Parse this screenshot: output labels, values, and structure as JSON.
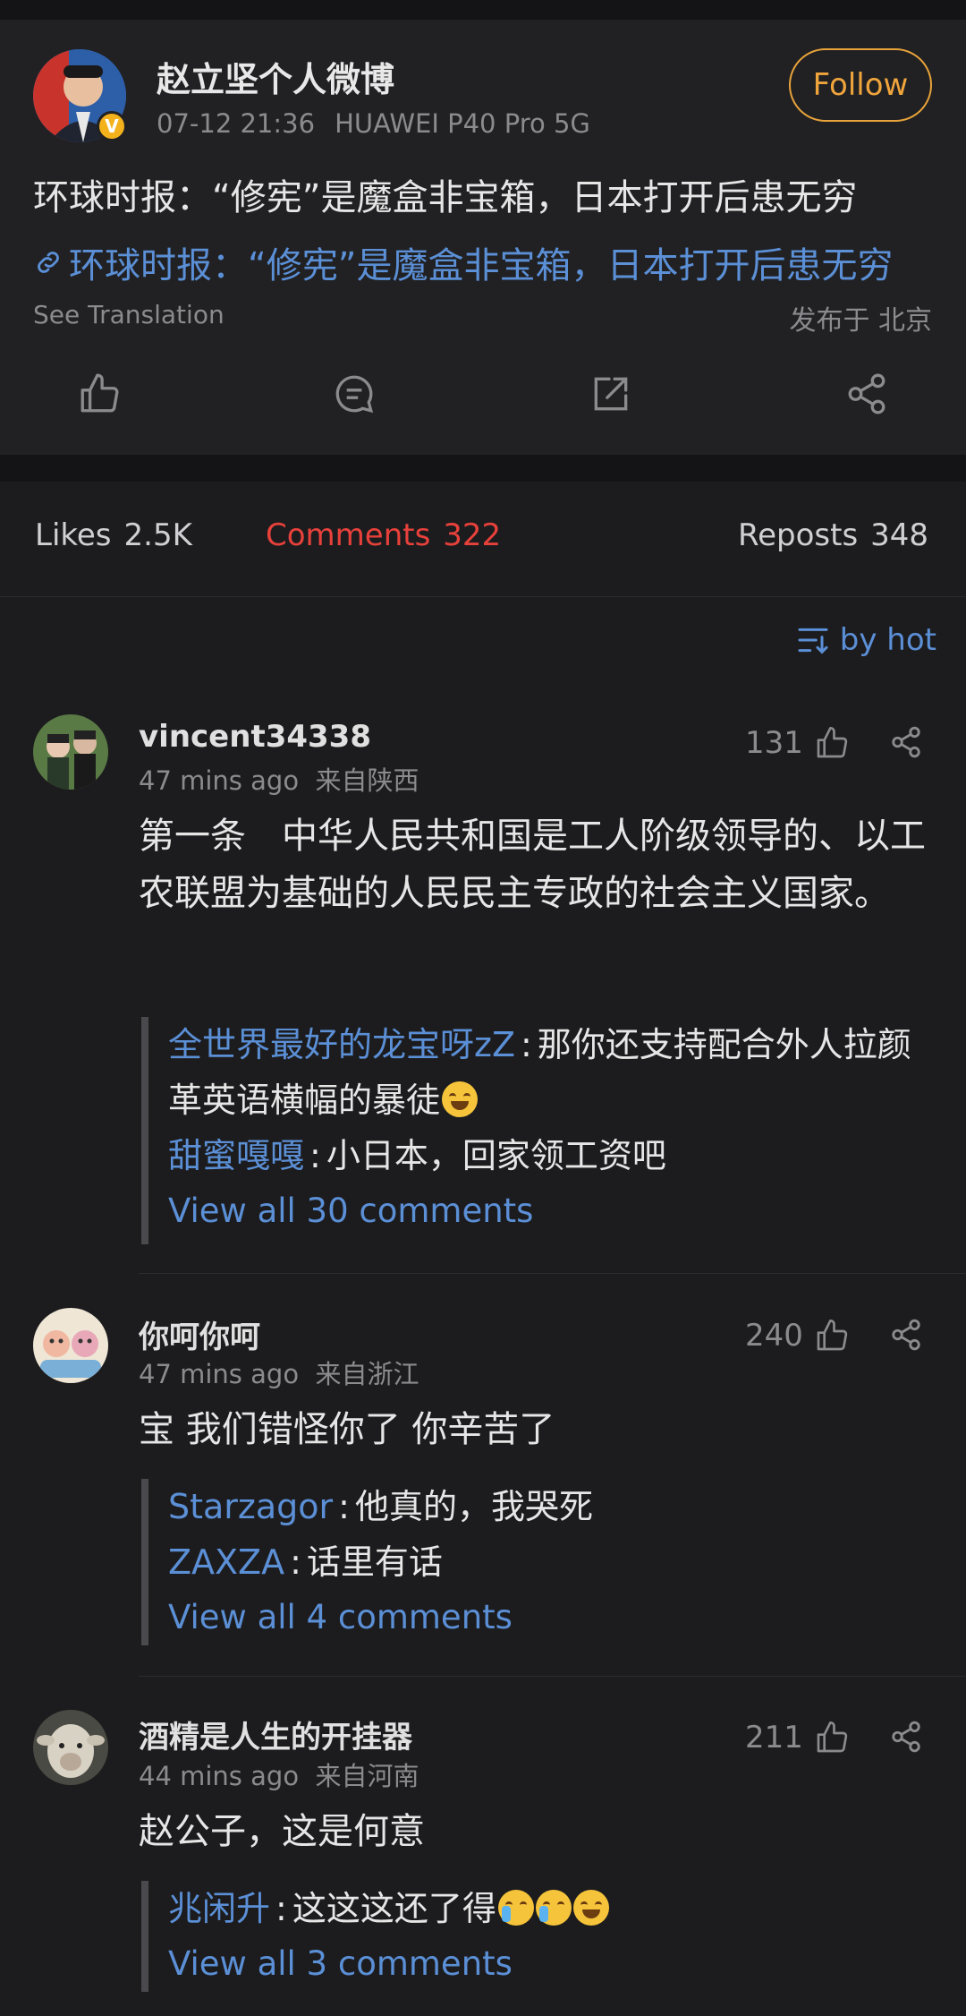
{
  "post": {
    "author": "赵立坚个人微博",
    "date": "07-12 21:36",
    "device": "HUAWEI P40 Pro 5G",
    "follow_label": "Follow",
    "text": "环球时报：“修宪”是魔盒非宝箱，日本打开后患无穷",
    "link_text": "环球时报：“修宪”是魔盒非宝箱，日本打开后患无穷",
    "see_translation": "See Translation",
    "location": "发布于 北京"
  },
  "stats": {
    "likes_label": "Likes",
    "likes_value": "2.5K",
    "comments_label": "Comments",
    "comments_value": "322",
    "reposts_label": "Reposts",
    "reposts_value": "348"
  },
  "sort_label": "by hot",
  "comments": [
    {
      "user": "vincent34338",
      "time": "47  mins ago",
      "region": "来自陕西",
      "likes": "131",
      "text": "第一条　中华人民共和国是工人阶级领导的、以工农联盟为基础的人民民主专政的社会主义国家。",
      "replies": [
        {
          "user": "全世界最好的龙宝呀zZ",
          "text": "那你还支持配合外人拉颜革英语横幅的暴徒"
        },
        {
          "user": "甜蜜嘎嘎",
          "text": "小日本，回家领工资吧"
        }
      ],
      "view_all": "View all 30 comments"
    },
    {
      "user": "你呵你呵",
      "time": "47  mins ago",
      "region": "来自浙江",
      "likes": "240",
      "text": "宝 我们错怪你了 你辛苦了",
      "replies": [
        {
          "user": "Starzagor",
          "text": "他真的，我哭死"
        },
        {
          "user": "ZAXZA",
          "text": "话里有话"
        }
      ],
      "view_all": "View all 4 comments"
    },
    {
      "user": "酒精是人生的开挂器",
      "time": "44  mins ago",
      "region": "来自河南",
      "likes": "211",
      "text": "赵公子，这是何意",
      "replies": [
        {
          "user": "兆闲升",
          "text": "这这这还了得"
        }
      ],
      "view_all": "View all 3 comments"
    }
  ],
  "colors": {
    "accent_blue": "#5b8fd6",
    "follow_orange": "#f0a53c",
    "active_red": "#e8413b",
    "background": "#1c1c1e"
  },
  "icons": [
    "like-icon",
    "comment-icon",
    "repost-icon",
    "share-icon",
    "link-icon",
    "sort-icon",
    "verified-badge-icon"
  ]
}
